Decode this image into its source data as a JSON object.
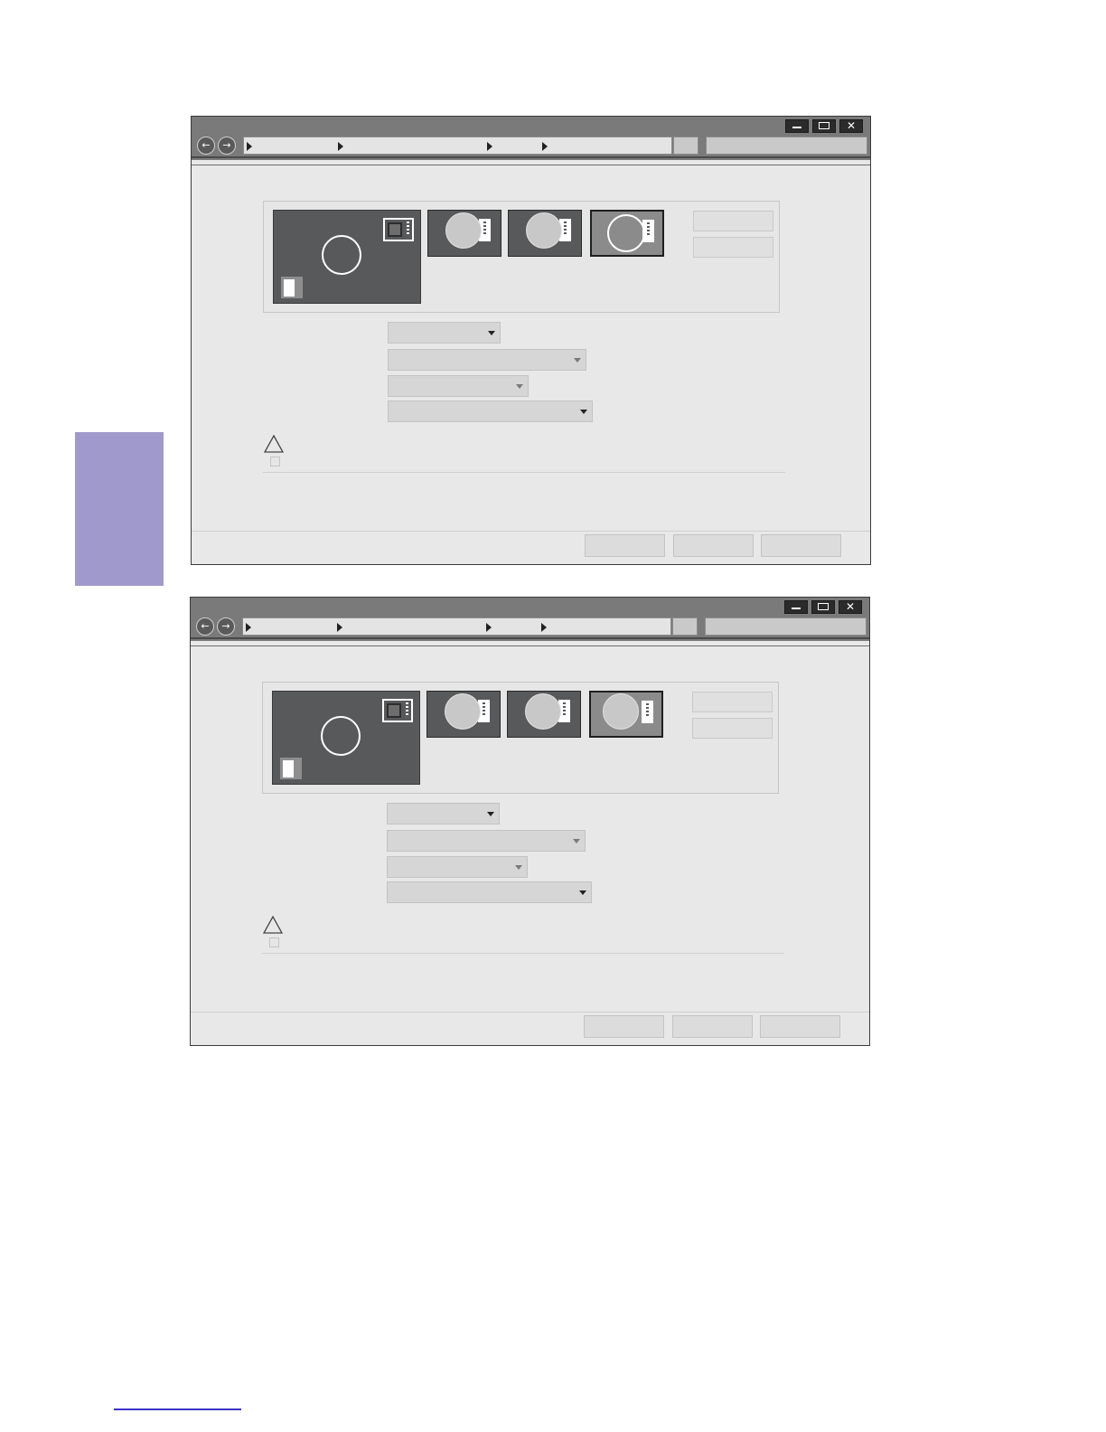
{
  "colors": {
    "side_tab": "#a099cc",
    "footer_rule": "#3b34c8",
    "titlebar": "#7a7a7b",
    "window_body": "#e8e8e9",
    "monitor_fill": "#58595b",
    "monitor_selected_fill": "#8b8b8c"
  },
  "icons": {
    "back": "←",
    "forward": "→",
    "close": "✕"
  },
  "windows": [
    {
      "selected_monitor_style": "ring"
    },
    {
      "selected_monitor_style": "disc"
    }
  ]
}
